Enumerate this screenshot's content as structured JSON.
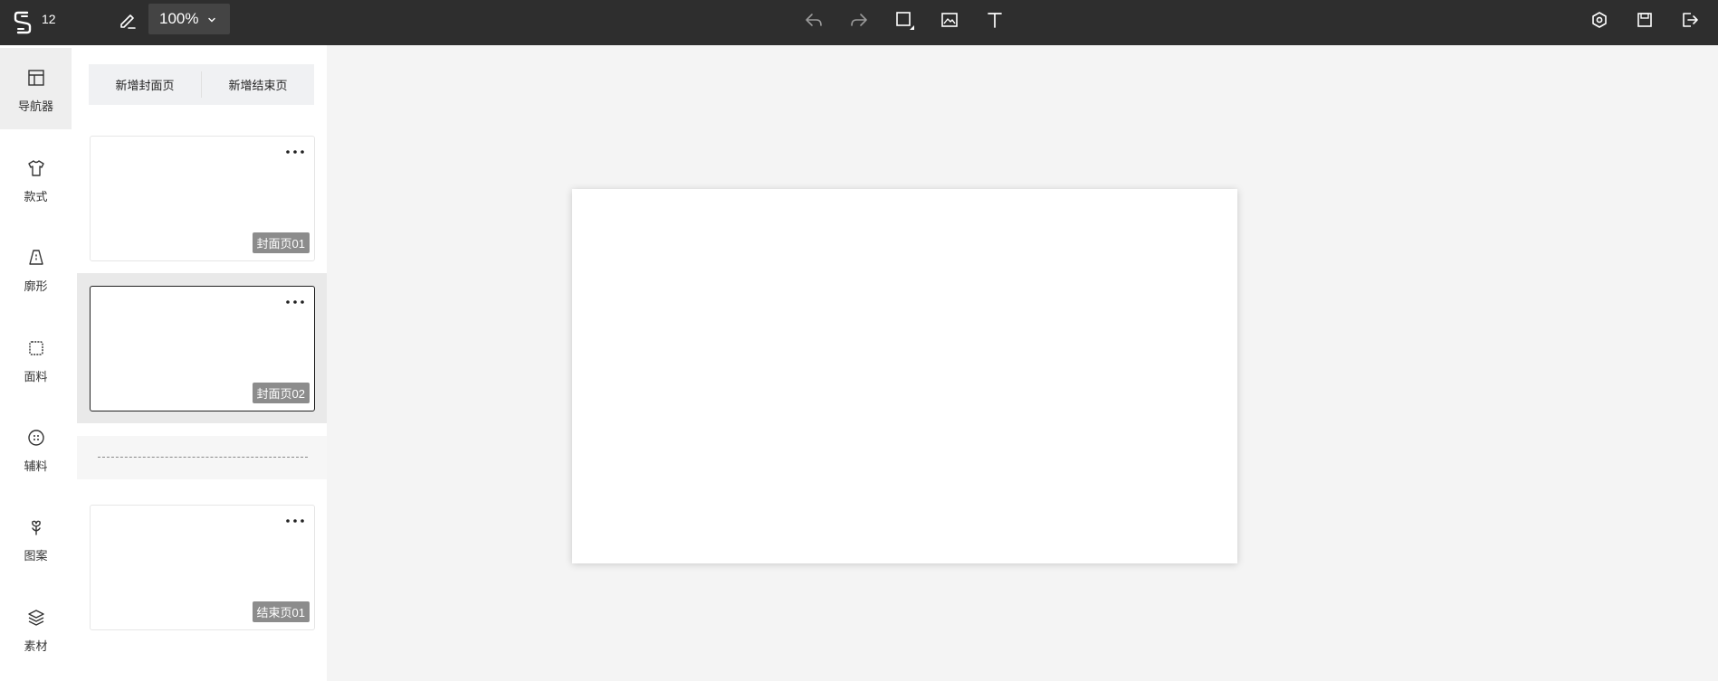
{
  "topbar": {
    "doc_number": "12",
    "zoom": "100%",
    "tools": [
      {
        "icon": "undo-icon"
      },
      {
        "icon": "redo-icon"
      },
      {
        "icon": "rectangle-icon"
      },
      {
        "icon": "image-icon"
      },
      {
        "icon": "text-icon"
      }
    ],
    "right_tools": [
      {
        "icon": "preview-icon"
      },
      {
        "icon": "save-icon"
      },
      {
        "icon": "exit-icon"
      }
    ]
  },
  "rail": {
    "items": [
      {
        "label": "导航器",
        "icon": "layout-icon",
        "active": true
      },
      {
        "label": "款式",
        "icon": "shirt-icon"
      },
      {
        "label": "廓形",
        "icon": "silhouette-icon"
      },
      {
        "label": "面料",
        "icon": "fabric-icon"
      },
      {
        "label": "辅料",
        "icon": "button-icon"
      },
      {
        "label": "图案",
        "icon": "pattern-icon"
      },
      {
        "label": "素材",
        "icon": "layers-icon"
      }
    ]
  },
  "panel": {
    "add_cover_label": "新增封面页",
    "add_end_label": "新增结束页",
    "pages": [
      {
        "tag": "封面页01"
      },
      {
        "tag": "封面页02",
        "selected": true
      },
      {
        "tag": "结束页01"
      }
    ]
  },
  "colors": {
    "topbar_bg": "#2e2e2e",
    "workspace_bg": "#f4f4f4",
    "tag_bg": "#8c8c8c"
  }
}
